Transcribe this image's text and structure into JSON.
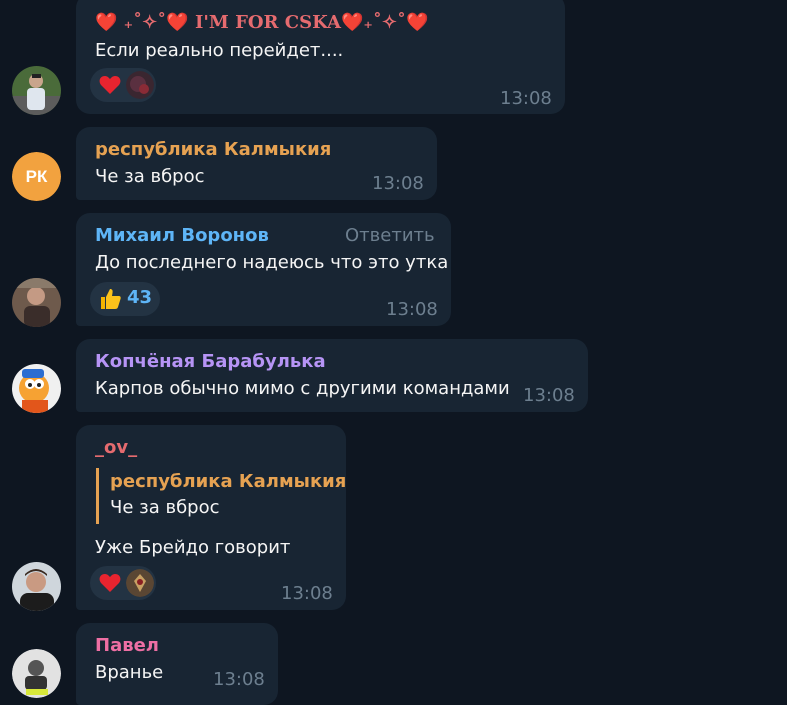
{
  "messages": [
    {
      "sender": "❤️ ₊˚✧˚❤️ I'M FOR CSKA❤️₊˚✧˚❤️",
      "text": "Если реально перейдет....",
      "time": "13:08",
      "reaction": {
        "emoji": "red-heart-icon",
        "count": null
      },
      "avatar": "user-photo"
    },
    {
      "sender": "республика Калмыкия",
      "sender_color": "#e6a252",
      "text": "Че за вброс",
      "time": "13:08",
      "avatar": {
        "initials": "РК",
        "color": "#f2a23f"
      }
    },
    {
      "sender": "Михаил Воронов",
      "sender_color": "#5eb5f7",
      "reply_label": "Ответить",
      "text": "До последнего надеюсь что это утка",
      "time": "13:08",
      "reaction": {
        "emoji": "thumbs-up-icon",
        "count": "43"
      },
      "avatar": "user-photo"
    },
    {
      "sender": "Копчёная Барабулька",
      "sender_color": "#b694f5",
      "text": "Карпов обычно мимо с другими командами",
      "time": "13:08",
      "avatar": "cartoon-character"
    },
    {
      "sender": "_ov_",
      "sender_color": "#e56b6f",
      "quote": {
        "sender": "республика Калмыкия",
        "text": "Че за вброс"
      },
      "text": "Уже Брейдо говорит",
      "time": "13:08",
      "reaction": {
        "emoji": "red-heart-icon",
        "count": null
      },
      "avatar": "user-photo"
    },
    {
      "sender": "Павел",
      "sender_color": "#ee6fa4",
      "text": "Вранье",
      "time": "13:08",
      "avatar": "user-photo"
    }
  ]
}
